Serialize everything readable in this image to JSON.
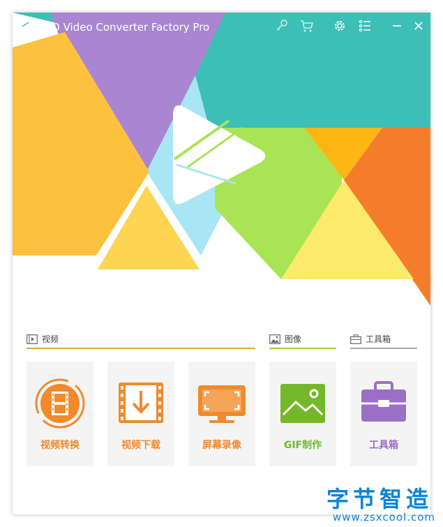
{
  "window": {
    "title": "HD Video Converter Factory Pro",
    "icons": {
      "logo": "play-logo-icon",
      "register": "key-icon",
      "buy": "cart-icon",
      "settings": "gear-icon",
      "menu": "list-menu-icon",
      "minimize": "minimize-icon",
      "close": "close-icon"
    }
  },
  "sections": [
    {
      "label": "视频",
      "icon": "film-icon",
      "line_color": "#e4a23c"
    },
    {
      "label": "图像",
      "icon": "image-icon",
      "line_color": "#a8c83c"
    },
    {
      "label": "工具箱",
      "icon": "toolbox-icon",
      "line_color": "#a9a9a9"
    }
  ],
  "tools": [
    {
      "label": "视频转换",
      "icon": "video-convert-icon",
      "color": "#f08a2c"
    },
    {
      "label": "视频下载",
      "icon": "video-download-icon",
      "color": "#f08a2c"
    },
    {
      "label": "屏幕录像",
      "icon": "screen-record-icon",
      "color": "#f08a2c"
    },
    {
      "label": "GIF制作",
      "icon": "gif-maker-icon",
      "color": "#74b82a"
    },
    {
      "label": "工具箱",
      "icon": "toolbox-icon",
      "color": "#9b6fc6"
    }
  ],
  "watermark": {
    "text": "字节智造",
    "url": "www.zsxcool.com"
  },
  "colors": {
    "teal": "#3dbfb6",
    "purple": "#a985d2",
    "yellow": "#fdc13e",
    "green": "#a9e455",
    "orange": "#f47d2b",
    "light_blue": "#a8e5f5"
  }
}
